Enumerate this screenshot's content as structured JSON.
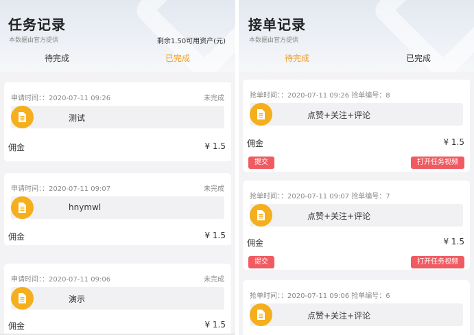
{
  "left": {
    "title": "任务记录",
    "subtitle": "本数据由官方提供",
    "balance": "剩余1.50可用资产(元)",
    "tabs": [
      {
        "label": "待完成",
        "active": false
      },
      {
        "label": "已完成",
        "active": true
      }
    ],
    "cards": [
      {
        "time": "申请时间：：2020-07-11 09:26",
        "status": "未完成",
        "content": "测试",
        "commission_label": "佣金",
        "commission_value": "¥ 1.5"
      },
      {
        "time": "申请时间：：2020-07-11 09:07",
        "status": "未完成",
        "content": "hnymwl",
        "commission_label": "佣金",
        "commission_value": "¥ 1.5"
      },
      {
        "time": "申请时间：：2020-07-11 09:06",
        "status": "未完成",
        "content": "演示",
        "commission_label": "佣金",
        "commission_value": "¥ 1.5"
      }
    ]
  },
  "right": {
    "title": "接单记录",
    "subtitle": "本数据由官方提供",
    "tabs": [
      {
        "label": "待完成",
        "active": true
      },
      {
        "label": "已完成",
        "active": false
      }
    ],
    "submit_label": "提交",
    "video_label": "打开任务视频",
    "cards": [
      {
        "time": "抢单时间：：2020-07-11 09:26 抢单编号：8",
        "content": "点赞+关注+评论",
        "commission_label": "佣金",
        "commission_value": "¥ 1.5"
      },
      {
        "time": "抢单时间：：2020-07-11 09:07 抢单编号：7",
        "content": "点赞+关注+评论",
        "commission_label": "佣金",
        "commission_value": "¥ 1.5"
      },
      {
        "time": "抢单时间：：2020-07-11 09:06 抢单编号：6",
        "content": "点赞+关注+评论"
      }
    ]
  },
  "colors": {
    "accent": "#f59a1c",
    "icon_bg": "#f5ae1c",
    "button": "#f05a61"
  },
  "icons": {
    "task": "document-icon"
  }
}
